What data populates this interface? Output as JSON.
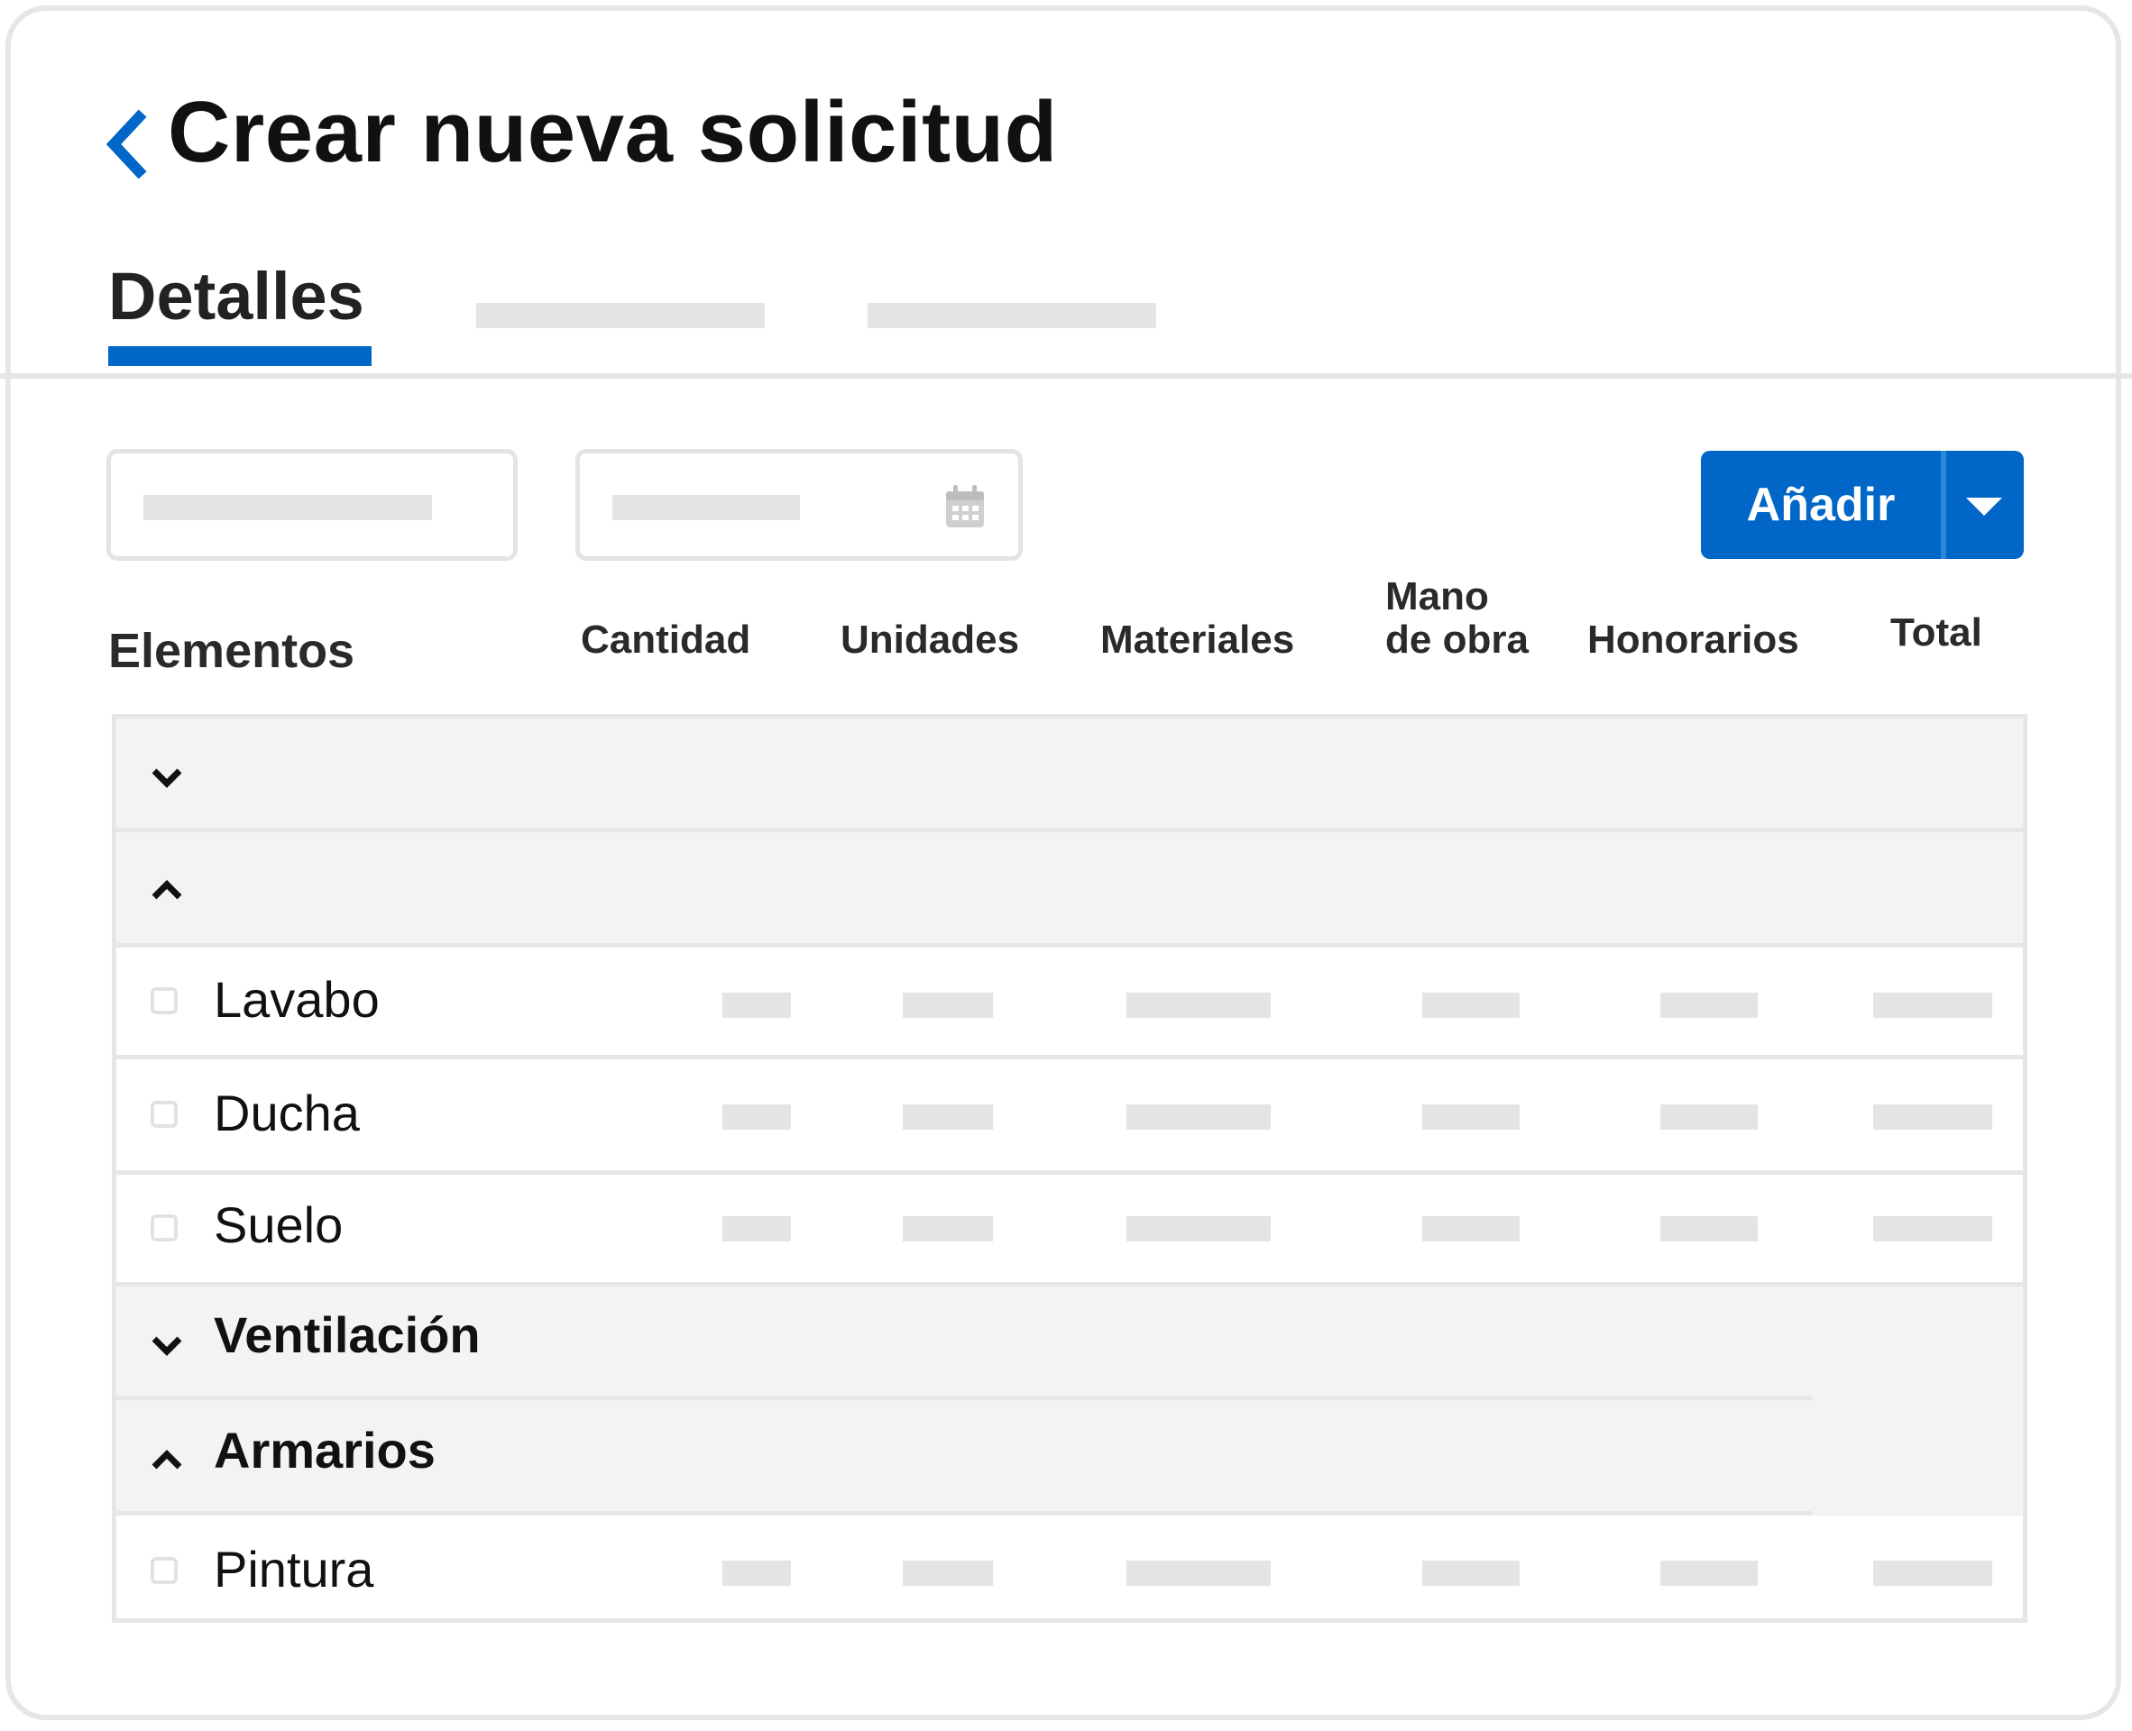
{
  "header": {
    "title": "Crear nueva solicitud",
    "back_icon": "chevron-left-icon",
    "accent_color": "#0066c8"
  },
  "tabs": [
    {
      "label": "Detalles",
      "active": true
    },
    {
      "label": "",
      "active": false
    },
    {
      "label": "",
      "active": false
    }
  ],
  "filters": {
    "text_input": {
      "value": ""
    },
    "date_input": {
      "value": "",
      "icon": "calendar-icon"
    }
  },
  "toolbar": {
    "add_label": "Añadir",
    "add_dropdown_icon": "caret-down-icon"
  },
  "columns": {
    "elementos": "Elementos",
    "cantidad": "Cantidad",
    "unidades": "Unidades",
    "materiales": "Materiales",
    "mano_line1": "Mano",
    "mano_line2": "de obra",
    "honorarios": "Honorarios",
    "total": "Total"
  },
  "rows": [
    {
      "type": "group",
      "label": "",
      "expanded": false,
      "icon": "chevron-down-icon"
    },
    {
      "type": "group",
      "label": "",
      "expanded": true,
      "icon": "chevron-up-icon"
    },
    {
      "type": "item",
      "label": "Lavabo",
      "checked": false
    },
    {
      "type": "item",
      "label": "Ducha",
      "checked": false
    },
    {
      "type": "item",
      "label": "Suelo",
      "checked": false
    },
    {
      "type": "group",
      "label": "Ventilación",
      "expanded": false,
      "icon": "chevron-down-icon"
    },
    {
      "type": "group",
      "label": "Armarios",
      "expanded": true,
      "icon": "chevron-up-icon"
    },
    {
      "type": "item",
      "label": "Pintura",
      "checked": false
    }
  ]
}
